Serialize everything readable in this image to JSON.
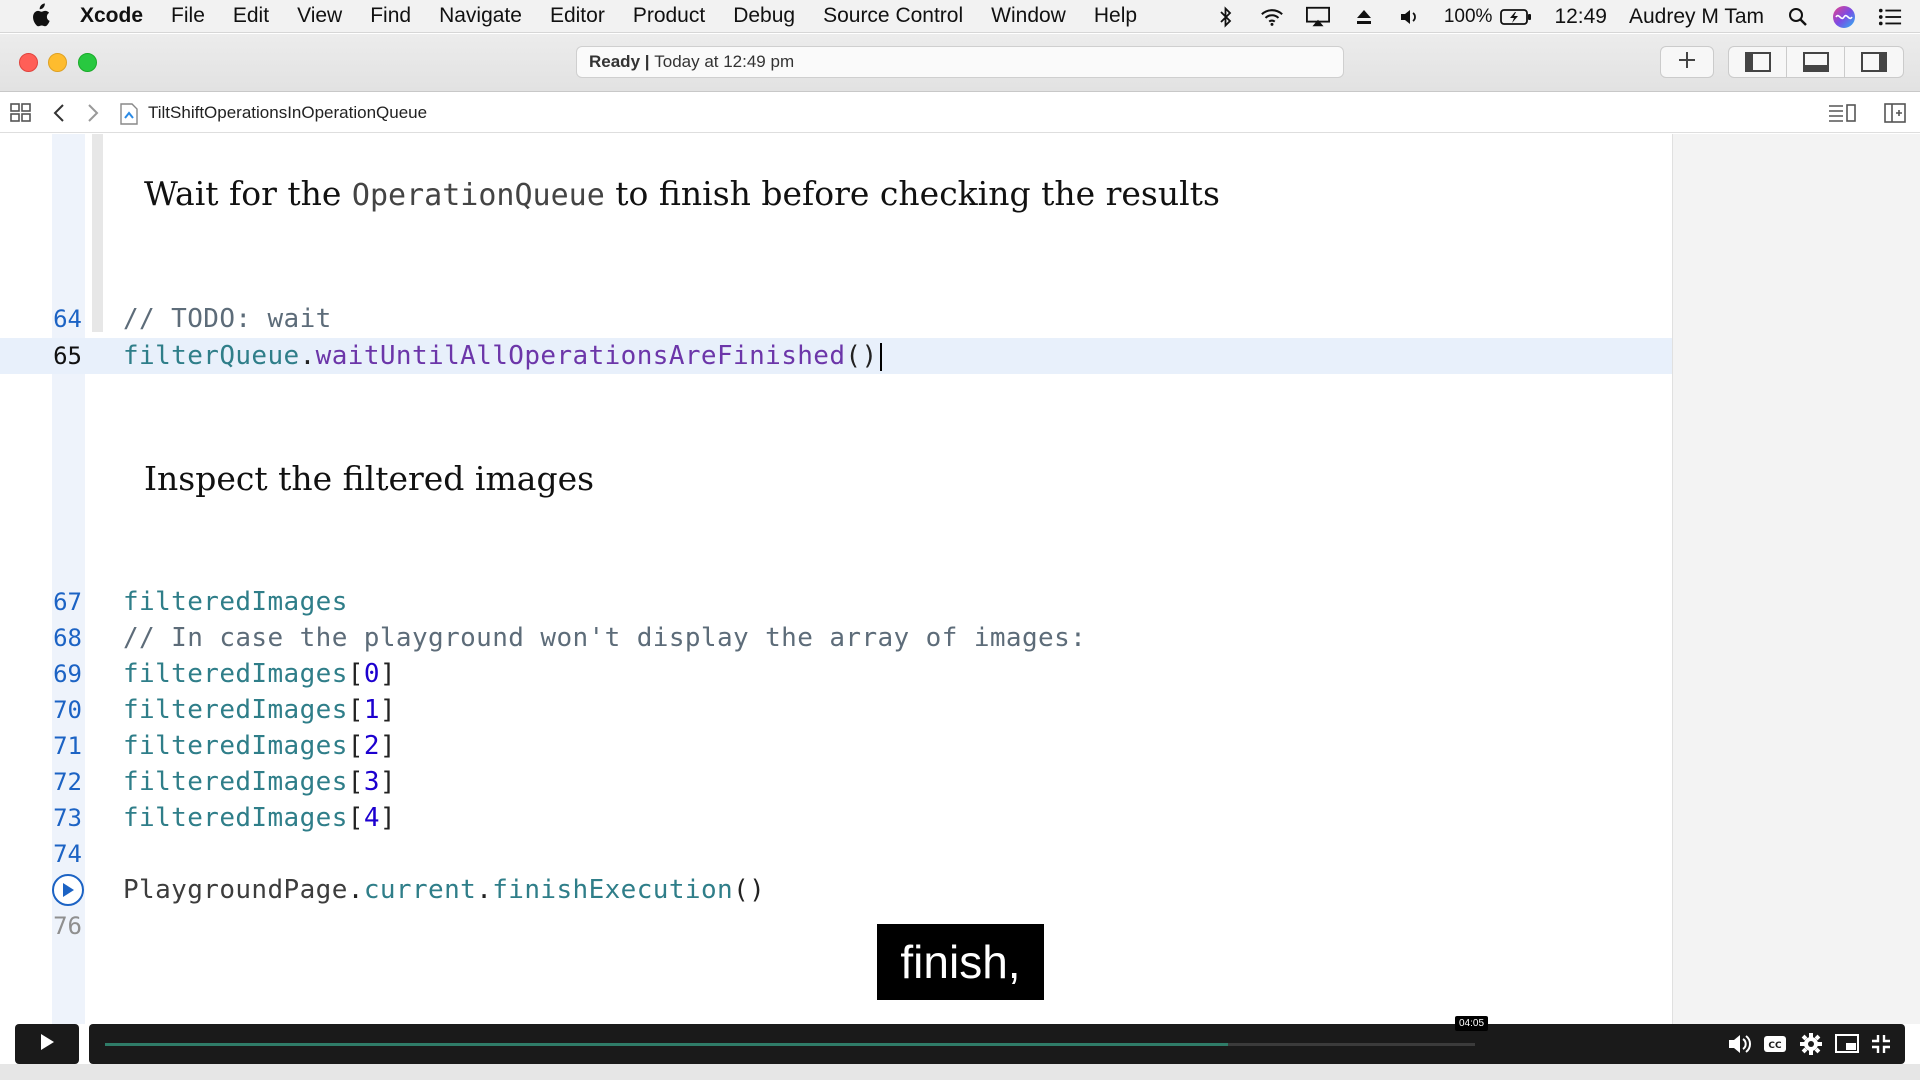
{
  "menubar": {
    "app_name": "Xcode",
    "items": [
      "File",
      "Edit",
      "View",
      "Find",
      "Navigate",
      "Editor",
      "Product",
      "Debug",
      "Source Control",
      "Window",
      "Help"
    ],
    "battery": "100%",
    "clock": "12:49",
    "user": "Audrey M Tam"
  },
  "toolbar": {
    "status_strong": "Ready",
    "status_separator": " | ",
    "status_detail": "Today at 12:49 pm"
  },
  "jumpbar": {
    "file": "TiltShiftOperationsInOperationQueue"
  },
  "editor": {
    "heading1_pre": "Wait for the ",
    "heading1_code": "OperationQueue",
    "heading1_post": " to finish before checking the results",
    "heading2": "Inspect the filtered images",
    "lines": [
      {
        "num": "64",
        "text": "// TODO: wait"
      },
      {
        "num": "65",
        "var": "filterQueue",
        "dot": ".",
        "method": "waitUntilAllOperationsAreFinished",
        "parens": "()"
      },
      {
        "num": "67",
        "text": "filteredImages"
      },
      {
        "num": "68",
        "text": "// In case the playground won't display the array of images:"
      },
      {
        "num": "69",
        "var": "filteredImages",
        "open": "[",
        "idx": "0",
        "close": "]"
      },
      {
        "num": "70",
        "var": "filteredImages",
        "open": "[",
        "idx": "1",
        "close": "]"
      },
      {
        "num": "71",
        "var": "filteredImages",
        "open": "[",
        "idx": "2",
        "close": "]"
      },
      {
        "num": "72",
        "var": "filteredImages",
        "open": "[",
        "idx": "3",
        "close": "]"
      },
      {
        "num": "73",
        "var": "filteredImages",
        "open": "[",
        "idx": "4",
        "close": "]"
      },
      {
        "num": "74",
        "text": ""
      },
      {
        "num": "",
        "type": "PlaygroundPage",
        "dot1": ".",
        "prop": "current",
        "dot2": ".",
        "method": "finishExecution",
        "parens": "()"
      },
      {
        "num": "76",
        "text": ""
      }
    ]
  },
  "caption": "finish,",
  "player": {
    "time": "04:05",
    "progress": 0.82,
    "accent": "#2f7c68"
  },
  "icons": [
    "apple-icon",
    "bluetooth-icon",
    "wifi-icon",
    "airplay-icon",
    "eject-icon",
    "volume-icon",
    "battery-icon",
    "spotlight-icon",
    "siri-icon",
    "notification-center-icon",
    "add-icon",
    "navigator-toggle-icon",
    "debug-area-toggle-icon",
    "inspector-toggle-icon",
    "grid-icon",
    "back-chevron-icon",
    "forward-chevron-icon",
    "playground-file-icon",
    "editor-options-icon",
    "add-editor-icon",
    "run-icon",
    "play-icon",
    "volume-icon",
    "cc-icon",
    "settings-icon",
    "miniplayer-icon",
    "fullscreen-exit-icon"
  ]
}
